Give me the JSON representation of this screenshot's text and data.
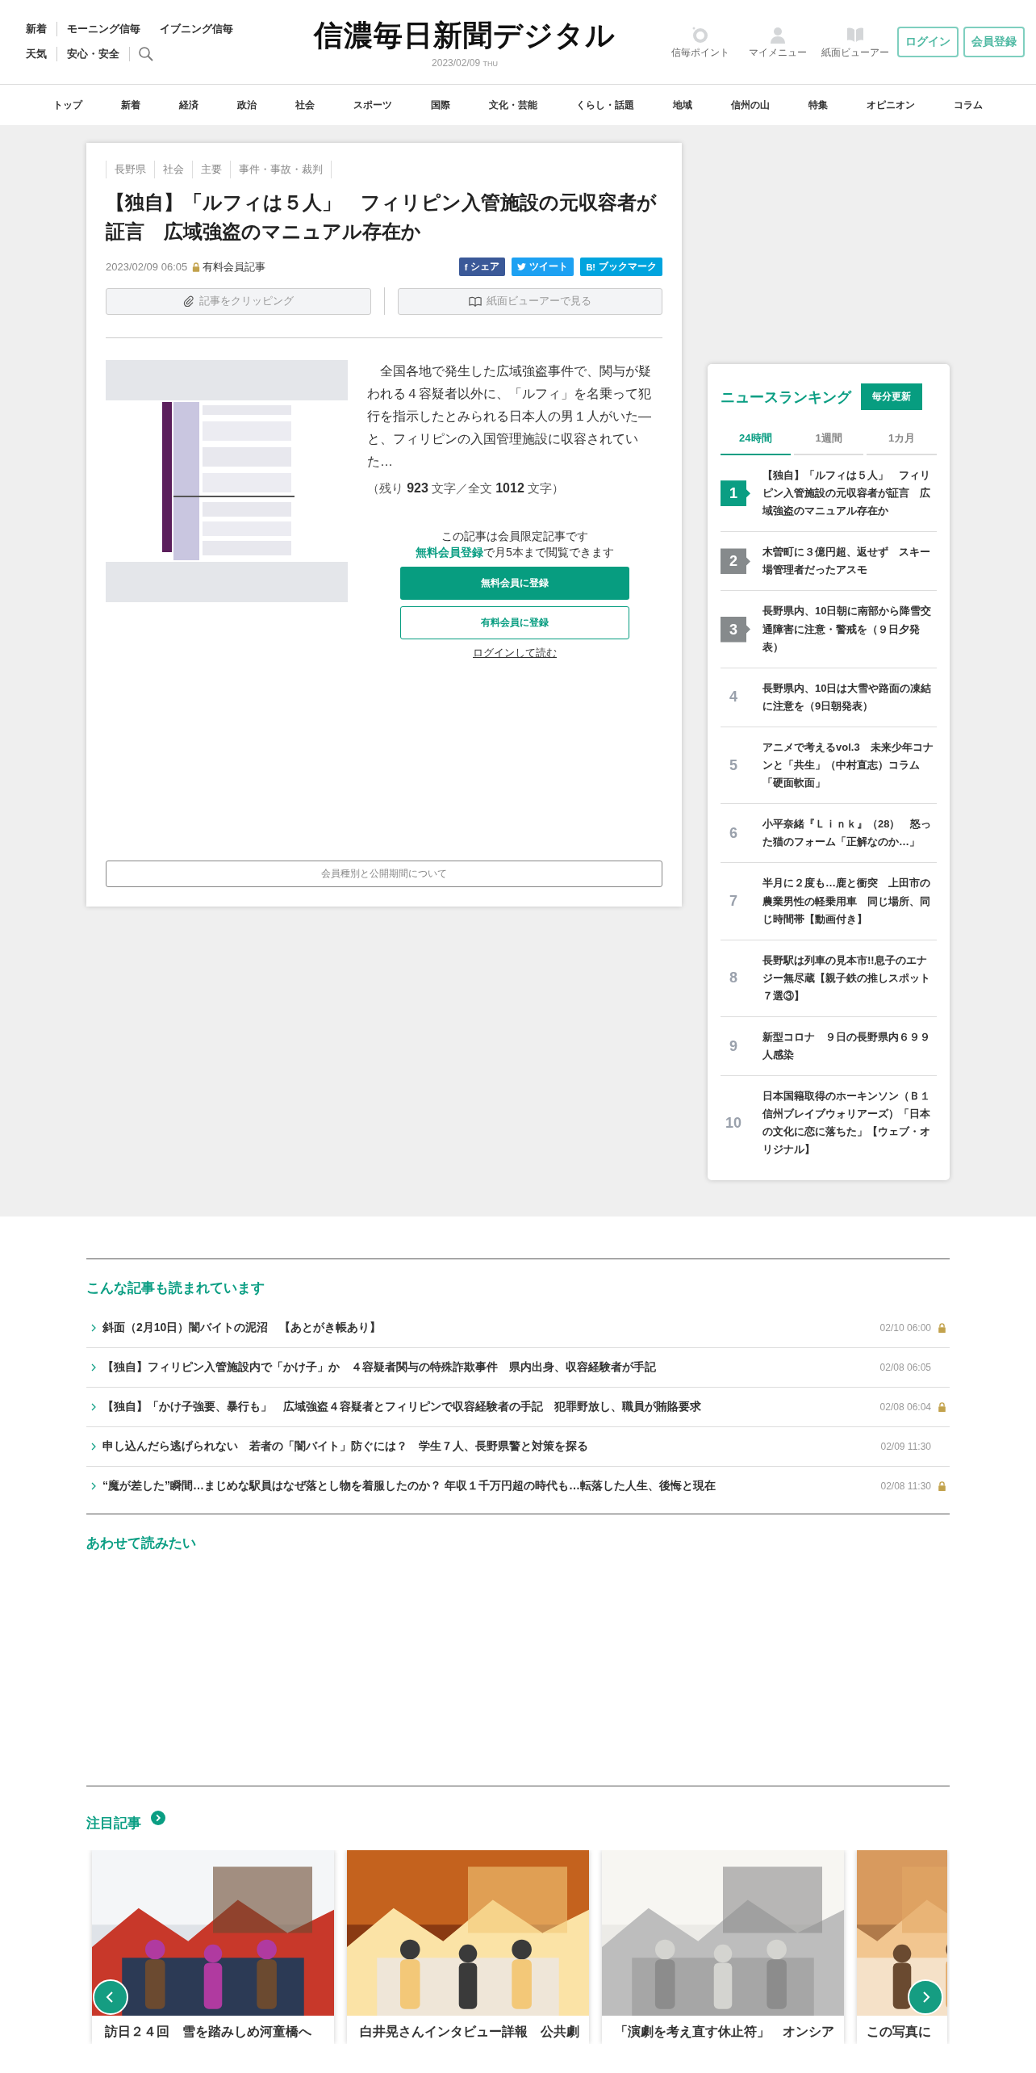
{
  "header": {
    "links_row1": [
      "新着",
      "モーニング信毎",
      "イブニング信毎"
    ],
    "links_row2": [
      "天気",
      "安心・安全"
    ],
    "logo": "信濃毎日新聞デジタル",
    "date": "2023/02/09",
    "weekday": "THU",
    "icon_links": [
      {
        "label": "信毎ポイント",
        "kind": "point"
      },
      {
        "label": "マイメニュー",
        "kind": "person"
      },
      {
        "label": "紙面ビューアー",
        "kind": "book"
      }
    ],
    "buttons": [
      "ログイン",
      "会員登録"
    ]
  },
  "nav": [
    "トップ",
    "新着",
    "経済",
    "政治",
    "社会",
    "スポーツ",
    "国際",
    "文化・芸能",
    "くらし・話題",
    "地域",
    "信州の山",
    "特集",
    "オピニオン",
    "コラム"
  ],
  "article": {
    "categories": [
      "長野県",
      "社会",
      "主要",
      "事件・事故・裁判"
    ],
    "title": "【独自】「ルフィは５人」　フィリピン入管施設の元収容者が証言　広域強盗のマニュアル存在か",
    "date": "2023/02/09 06:05",
    "member_label": "有料会員記事",
    "share": [
      {
        "kind": "facebook",
        "icon": "f",
        "label": "シェア"
      },
      {
        "kind": "twitter",
        "label": "ツイート"
      },
      {
        "kind": "hatena",
        "icon": "B!",
        "label": "ブックマーク"
      }
    ],
    "actions": [
      {
        "kind": "clip",
        "label": "記事をクリッピング"
      },
      {
        "kind": "viewer",
        "label": "紙面ビューアーで見る"
      }
    ],
    "image": {
      "kind": "picture"
    },
    "lead": "　全国各地で発生した広域強盗事件で、関与が疑われる４容疑者以外に、「ルフィ」を名乗って犯行を指示したとみられる日本人の男１人がいた―と、フィリピンの入国管理施設に収容されていた…",
    "remaining": "（残り **923** 文字／全文 **1012** 文字）",
    "paywall": {
      "notice": "この記事は会員限定記事です",
      "link": "無料会員登録",
      "notice_rest": "で月5本まで閲覧できます",
      "free_button": "無料会員に登録",
      "paid_button": "有料会員に登録",
      "login": "ログインして読む"
    },
    "footer_button": "会員種別と公開期間について"
  },
  "ranking": {
    "title": "ニュースランキング",
    "badge": "毎分更新",
    "tabs": [
      {
        "label": "24時間",
        "selected": true
      },
      {
        "label": "1週間",
        "selected": false
      },
      {
        "label": "1カ月",
        "selected": false
      }
    ],
    "items": [
      {
        "rank": "1",
        "kind": "badge",
        "color": "#0a9e83",
        "title": "【独自】「ルフィは５人」　フィリピン入管施設の元収容者が証言　広域強盗のマニュアル存在か"
      },
      {
        "rank": "2",
        "kind": "badge",
        "color": "#868a8c",
        "title": "木曽町に３億円超、返せず　スキー場管理者だったアスモ"
      },
      {
        "rank": "3",
        "kind": "badge",
        "color": "#868a8c",
        "title": "長野県内、10日朝に南部から降雪交通障害に注意・警戒を（９日夕発表）"
      },
      {
        "rank": "4",
        "kind": "plain",
        "title": "長野県内、10日は大雪や路面の凍結に注意を（9日朝発表）"
      },
      {
        "rank": "5",
        "kind": "plain",
        "title": "アニメで考えるvol.3　未来少年コナンと「共生」（中村直志）コラム「硬面軟面」"
      },
      {
        "rank": "6",
        "kind": "plain",
        "title": "小平奈緒『Ｌｉｎｋ』（28）　怒った猫のフォーム「正解なのか…」"
      },
      {
        "rank": "7",
        "kind": "plain",
        "title": "半月に２度も…鹿と衝突　上田市の農業男性の軽乗用車　同じ場所、同じ時間帯【動画付き】"
      },
      {
        "rank": "8",
        "kind": "plain",
        "title": "長野駅は列車の見本市!!息子のエナジー無尽蔵【親子鉄の推しスポット７選③】"
      },
      {
        "rank": "9",
        "kind": "plain",
        "title": "新型コロナ　９日の長野県内６９９人感染"
      },
      {
        "rank": "10",
        "kind": "plain",
        "title": "日本国籍取得のホーキンソン（Ｂ１信州ブレイブウォリアーズ）「日本の文化に恋に落ちた」【ウェブ・オリジナル】"
      }
    ]
  },
  "popular": {
    "heading": "こんな記事も読まれています",
    "items": [
      {
        "title": "斜面（2月10日）闇バイトの泥沼　【あとがき帳あり】",
        "time": "02/10 06:00",
        "locked": true
      },
      {
        "title": "【独自】フィリピン入管施設内で「かけ子」か　４容疑者関与の特殊詐欺事件　県内出身、収容経験者が手記",
        "time": "02/08 06:05",
        "locked": false
      },
      {
        "title": "【独自】「かけ子強要、暴行も」　広域強盗４容疑者とフィリピンで収容経験者の手記　犯罪野放し、職員が賄賂要求",
        "time": "02/08 06:04",
        "locked": true
      },
      {
        "title": "申し込んだら逃げられない　若者の「闇バイト」防ぐには？　学生７人、長野県警と対策を探る",
        "time": "02/09 11:30",
        "locked": false
      },
      {
        "title": "“魔が差した”瞬間…まじめな駅員はなぜ落とし物を着服したのか？ 年収１千万円超の時代も…転落した人生、後悔と現在",
        "time": "02/08 11:30",
        "locked": true
      }
    ]
  },
  "related": {
    "heading": "あわせて読みたい"
  },
  "featured": {
    "heading": "注目記事",
    "cards": [
      {
        "title": "訪日２４回　雪を踏みしめ河童橋へ",
        "kind": "picture"
      },
      {
        "title": "白井晃さんインタビュー詳報　公共劇",
        "kind": "picture"
      },
      {
        "title": "「演劇を考え直す休止符」　オンシア",
        "kind": "picture"
      },
      {
        "title": "この写真に",
        "kind": "picture"
      }
    ]
  }
}
